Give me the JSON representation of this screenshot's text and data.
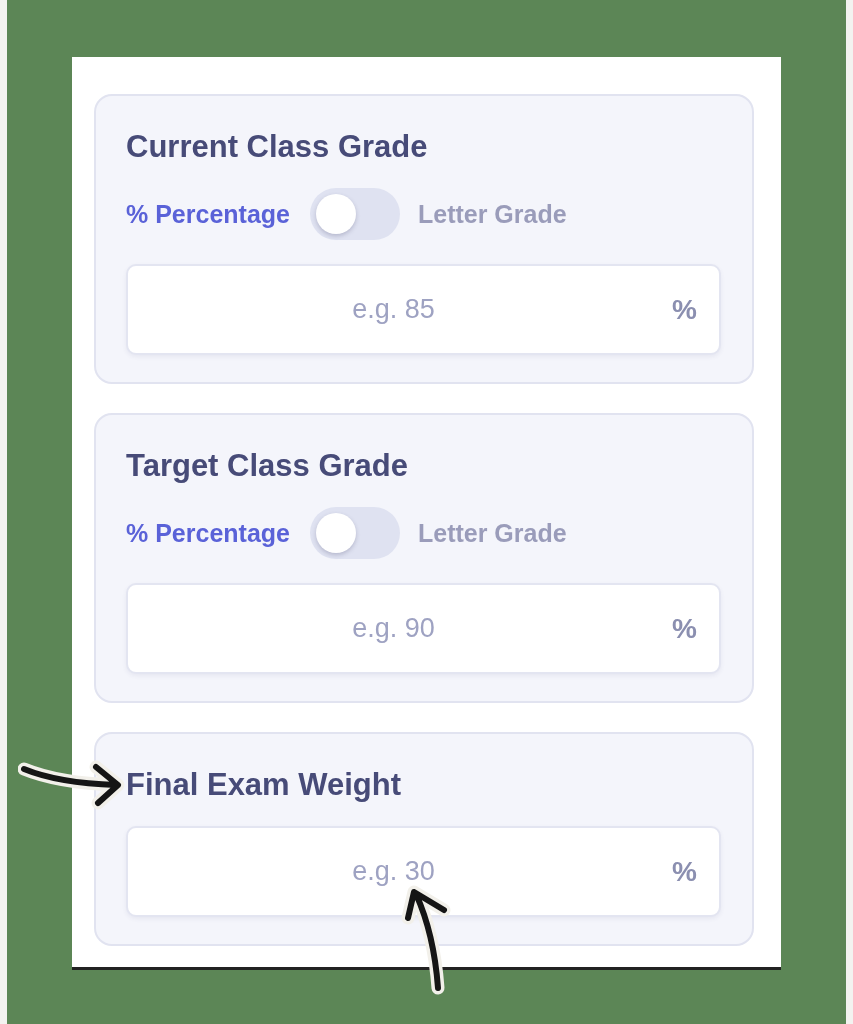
{
  "cards": [
    {
      "title": "Current Class Grade",
      "switch": {
        "left_label": "% Percentage",
        "right_label": "Letter Grade",
        "on": false
      },
      "input": {
        "placeholder": "e.g. 85",
        "unit": "%"
      }
    },
    {
      "title": "Target Class Grade",
      "switch": {
        "left_label": "% Percentage",
        "right_label": "Letter Grade",
        "on": false
      },
      "input": {
        "placeholder": "e.g. 90",
        "unit": "%"
      }
    },
    {
      "title": "Final Exam Weight",
      "input": {
        "placeholder": "e.g. 30",
        "unit": "%"
      }
    }
  ]
}
